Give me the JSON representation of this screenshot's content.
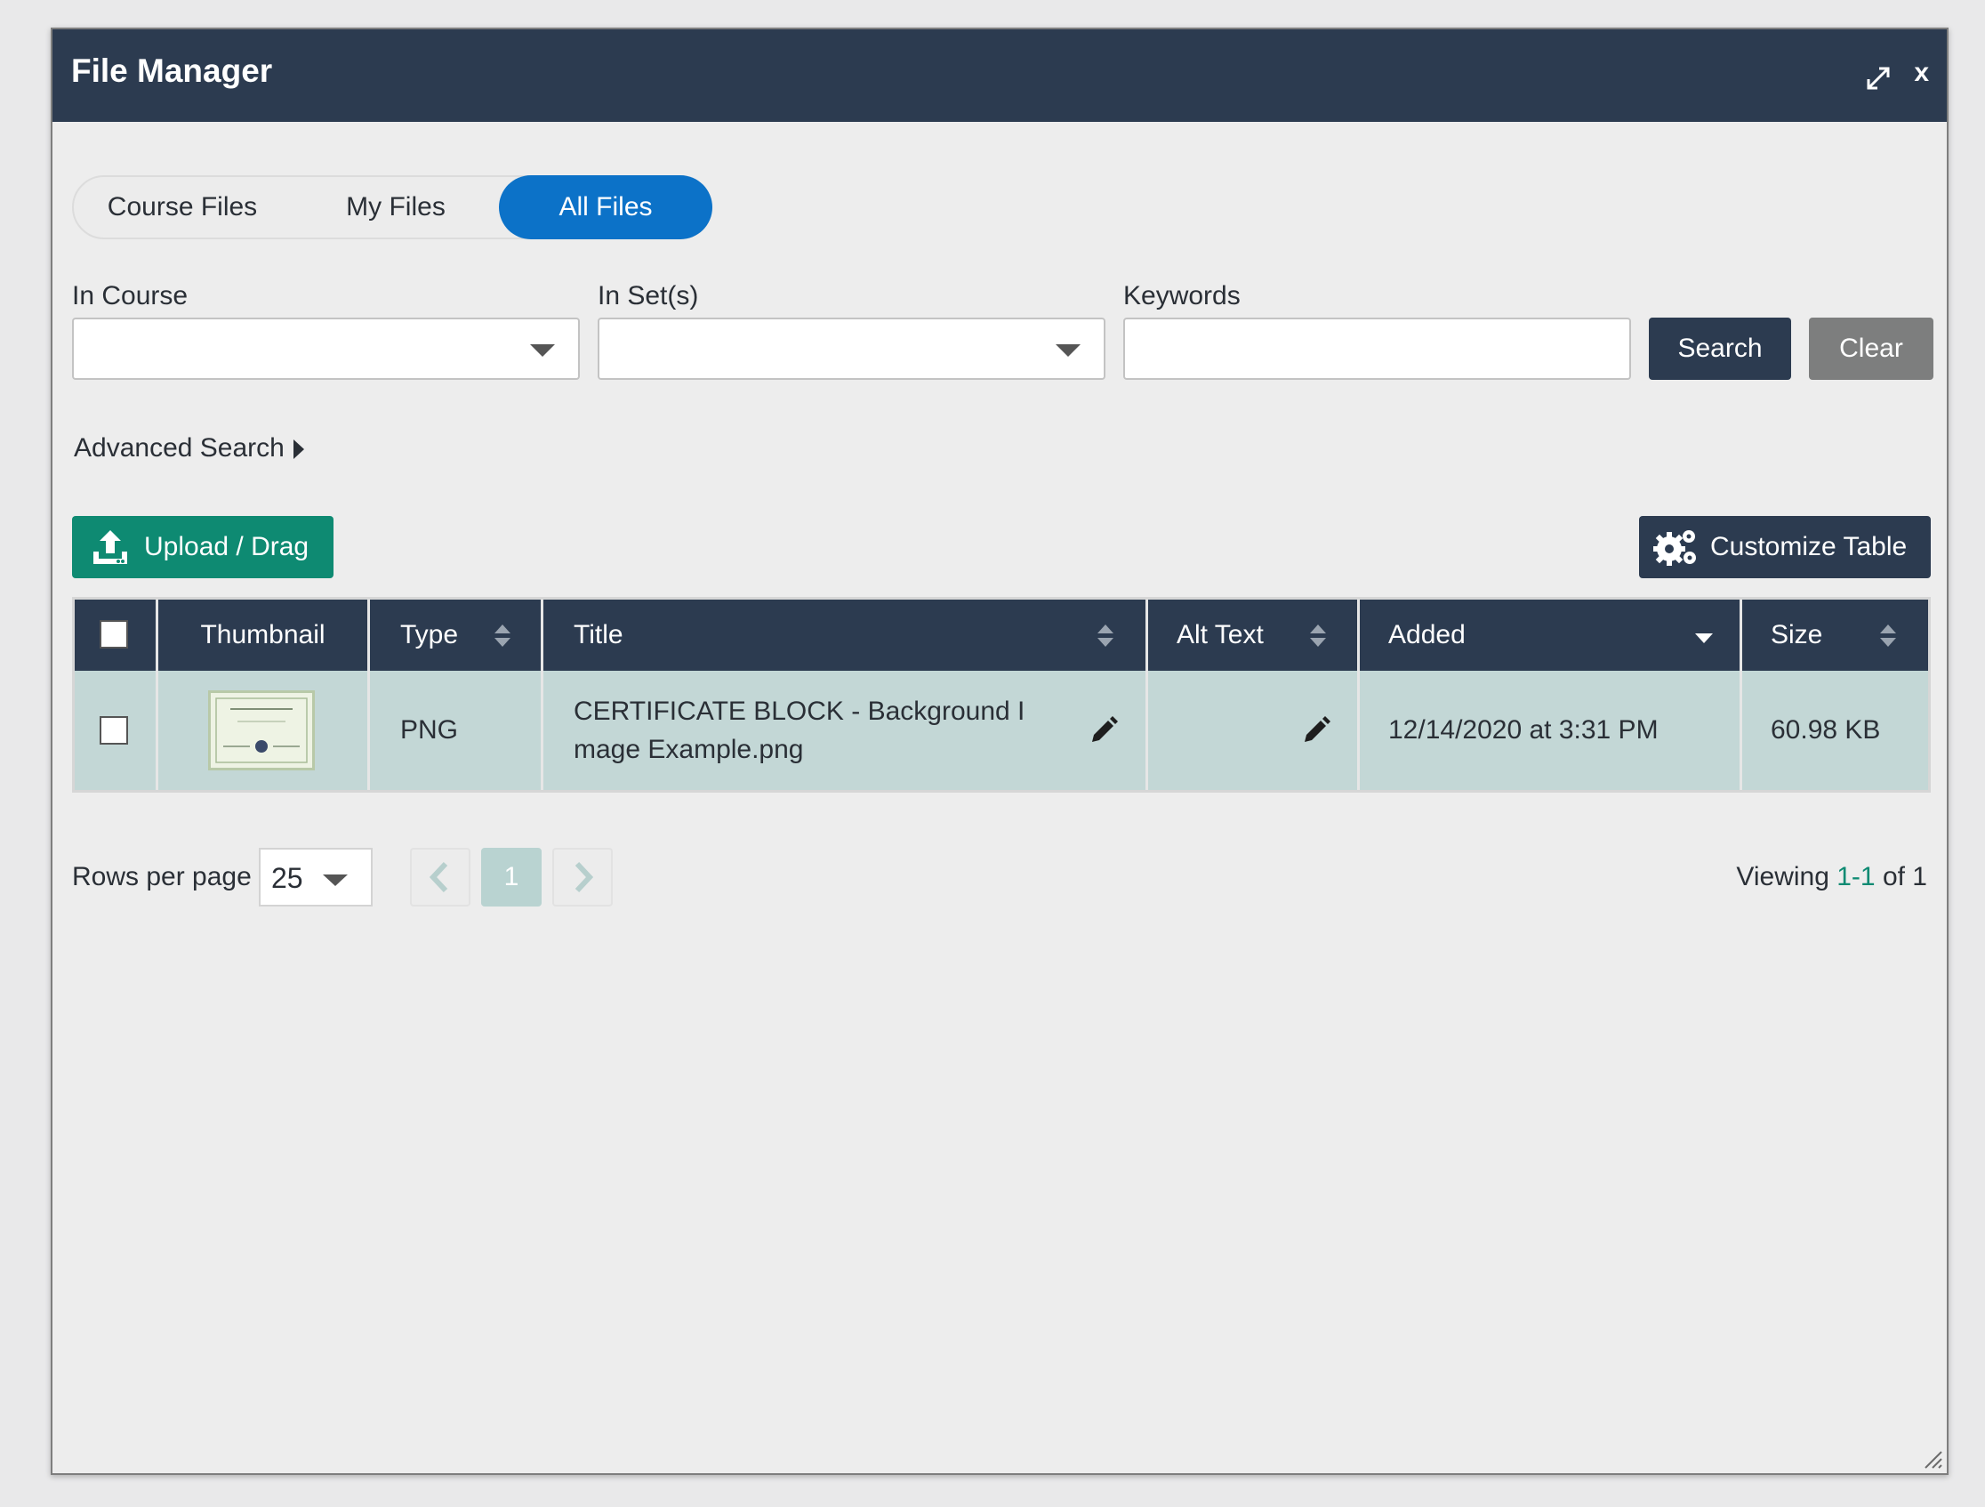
{
  "window": {
    "title": "File Manager",
    "close_label": "x"
  },
  "tabs": [
    {
      "label": "Course Files",
      "active": false
    },
    {
      "label": "My Files",
      "active": false
    },
    {
      "label": "All Files",
      "active": true
    }
  ],
  "filters": {
    "in_course": {
      "label": "In Course",
      "value": ""
    },
    "in_sets": {
      "label": "In Set(s)",
      "value": ""
    },
    "keywords": {
      "label": "Keywords",
      "value": ""
    },
    "search_label": "Search",
    "clear_label": "Clear",
    "advanced_label": "Advanced Search"
  },
  "toolbar": {
    "upload_label": "Upload / Drag",
    "customize_label": "Customize Table"
  },
  "table": {
    "columns": [
      "Thumbnail",
      "Type",
      "Title",
      "Alt Text",
      "Added",
      "Size"
    ],
    "sorted_column": "Added",
    "rows": [
      {
        "type": "PNG",
        "title_line1": "CERTIFICATE BLOCK - Background I",
        "title_line2": "mage Example.png",
        "alt_text": "",
        "added": "12/14/2020 at 3:31 PM",
        "size": "60.98 KB"
      }
    ]
  },
  "pagination": {
    "rows_per_page_label": "Rows per page",
    "rows_per_page": "25",
    "current_page": "1",
    "viewing_prefix": "Viewing",
    "viewing_range": "1-1",
    "viewing_suffix": "of 1"
  },
  "colors": {
    "titlebar": "#2c3b50",
    "active_tab": "#0c72c8",
    "upload_button": "#0e8a72",
    "row_highlight": "#c3d7d6"
  },
  "icons": [
    "expand-icon",
    "close-icon",
    "caret-down-icon",
    "caret-right-icon",
    "upload-icon",
    "gears-icon",
    "sort-icon",
    "sort-desc-icon",
    "pencil-icon",
    "chevron-left-icon",
    "chevron-right-icon",
    "resize-handle-icon"
  ]
}
